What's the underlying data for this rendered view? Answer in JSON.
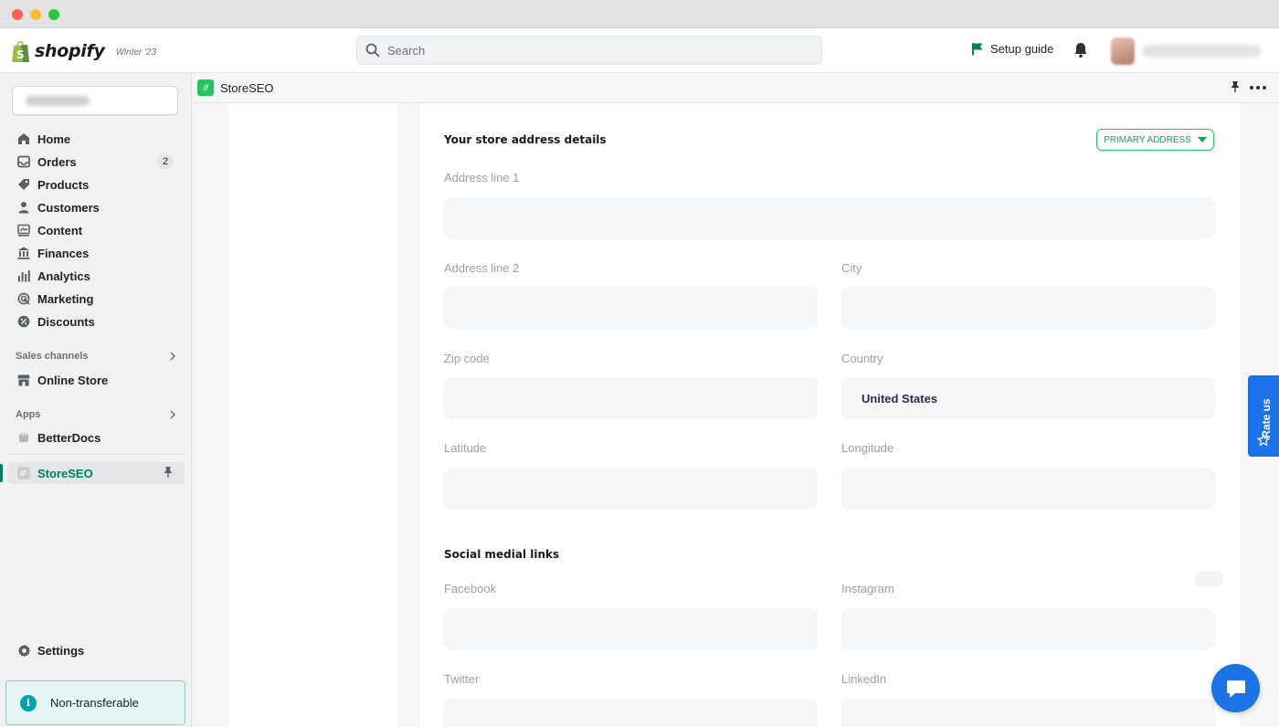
{
  "topbar": {
    "brand": "shopify",
    "edition": "Winter '23",
    "search_placeholder": "Search",
    "setup_guide": "Setup guide"
  },
  "sidebar": {
    "items": [
      {
        "label": "Home",
        "icon": "home-icon"
      },
      {
        "label": "Orders",
        "icon": "orders-icon",
        "badge": "2"
      },
      {
        "label": "Products",
        "icon": "tag-icon"
      },
      {
        "label": "Customers",
        "icon": "person-icon"
      },
      {
        "label": "Content",
        "icon": "content-icon"
      },
      {
        "label": "Finances",
        "icon": "bank-icon"
      },
      {
        "label": "Analytics",
        "icon": "bar-chart-icon"
      },
      {
        "label": "Marketing",
        "icon": "target-icon"
      },
      {
        "label": "Discounts",
        "icon": "discount-icon"
      }
    ],
    "sales_channels_label": "Sales channels",
    "online_store": "Online Store",
    "apps_label": "Apps",
    "betterdocs": "BetterDocs",
    "storeseo": "StoreSEO",
    "settings": "Settings",
    "non_transferable": "Non-transferable"
  },
  "appbar": {
    "name": "StoreSEO"
  },
  "form": {
    "address_title": "Your store address details",
    "primary_address_button": "PRIMARY ADDRESS",
    "address_line_1_label": "Address line 1",
    "address_line_2_label": "Address line 2",
    "city_label": "City",
    "zip_label": "Zip code",
    "country_label": "Country",
    "country_value": "United States",
    "latitude_label": "Latitude",
    "longitude_label": "Longitude",
    "social_title": "Social medial links",
    "facebook_label": "Facebook",
    "instagram_label": "Instagram",
    "twitter_label": "Twitter",
    "linkedin_label": "LinkedIn"
  },
  "widgets": {
    "rate_us": "Rate us"
  },
  "colors": {
    "accent_green": "#008060",
    "app_green": "#22c55e",
    "rate_blue": "#1c73e8"
  }
}
